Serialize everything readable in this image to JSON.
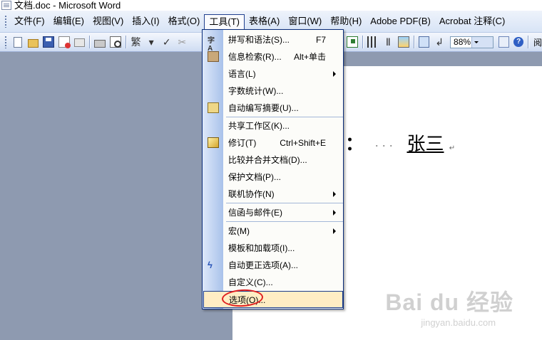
{
  "window": {
    "title": "文档.doc - Microsoft Word"
  },
  "menubar": {
    "items": [
      "文件(F)",
      "编辑(E)",
      "视图(V)",
      "插入(I)",
      "格式(O)",
      "工具(T)",
      "表格(A)",
      "窗口(W)",
      "帮助(H)",
      "Adobe PDF(B)",
      "Acrobat 注释(C)"
    ],
    "active": "工具(T)"
  },
  "toolbar": {
    "style_label": "繁",
    "zoom": "88%",
    "more_label": "阅"
  },
  "tools_menu": {
    "items": [
      {
        "label": "拼写和语法(S)...",
        "shortcut": "F7",
        "icon": "spelling-icon"
      },
      {
        "label": "信息检索(R)...",
        "shortcut": "Alt+单击",
        "icon": "research-icon"
      },
      {
        "label": "语言(L)",
        "submenu": true
      },
      {
        "label": "字数统计(W)..."
      },
      {
        "label": "自动编写摘要(U)...",
        "icon": "autosummary-icon"
      },
      {
        "label": "共享工作区(K)..."
      },
      {
        "label": "修订(T)",
        "shortcut": "Ctrl+Shift+E",
        "icon": "track-changes-icon"
      },
      {
        "label": "比较并合并文档(D)..."
      },
      {
        "label": "保护文档(P)..."
      },
      {
        "label": "联机协作(N)",
        "submenu": true
      },
      {
        "label": "信函与邮件(E)",
        "submenu": true
      },
      {
        "label": "宏(M)",
        "submenu": true
      },
      {
        "label": "模板和加载项(I)..."
      },
      {
        "label": "自动更正选项(A)...",
        "icon": "autocorrect-icon"
      },
      {
        "label": "自定义(C)..."
      },
      {
        "label": "选项(O)...",
        "highlighted": true
      }
    ]
  },
  "document": {
    "colon": "：",
    "dots": "···",
    "name": "张三",
    "pilcrow": "↵"
  },
  "watermark": {
    "brand": "Bai du 经验",
    "sub": "jingyan.baidu.com"
  }
}
